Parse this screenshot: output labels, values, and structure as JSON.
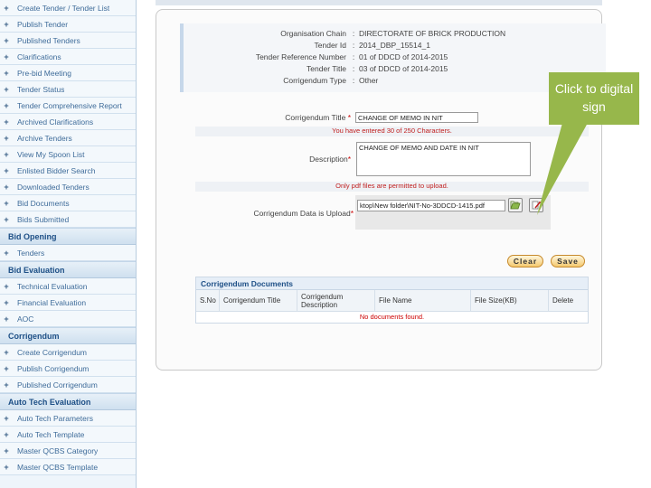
{
  "sidebar": {
    "group1": [
      "Create Tender / Tender List",
      "Publish Tender",
      "Published Tenders",
      "Clarifications",
      "Pre-bid Meeting",
      "Tender Status",
      "Tender Comprehensive Report",
      "Archived Clarifications",
      "Archive Tenders",
      "View My Spoon List",
      "Enlisted Bidder Search",
      "Downloaded Tenders",
      "Bid Documents",
      "Bids Submitted"
    ],
    "bid_opening": {
      "title": "Bid Opening",
      "items": [
        "Tenders"
      ]
    },
    "bid_evaluation": {
      "title": "Bid Evaluation",
      "items": [
        "Technical Evaluation",
        "Financial Evaluation",
        "AOC"
      ]
    },
    "corrigendum": {
      "title": "Corrigendum",
      "items": [
        "Create Corrigendum",
        "Publish Corrigendum",
        "Published Corrigendum"
      ]
    },
    "auto_tech": {
      "title": "Auto Tech Evaluation",
      "items": [
        "Auto Tech Parameters",
        "Auto Tech Template",
        "Master QCBS Category",
        "Master QCBS Template"
      ]
    }
  },
  "info": {
    "org_label": "Organisation Chain",
    "org_value": "DIRECTORATE OF BRICK PRODUCTION",
    "tid_label": "Tender Id",
    "tid_value": "2014_DBP_15514_1",
    "ref_label": "Tender Reference Number",
    "ref_value": "01 of DDCD of 2014-2015",
    "title_label": "Tender Title",
    "title_value": "03 of DDCD of 2014-2015",
    "type_label": "Corrigendum Type",
    "type_value": "Other"
  },
  "form": {
    "ctitle_label": "Corrigendum Title",
    "ctitle_value": "CHANGE OF MEMO IN NIT",
    "char_note": "You have entered 30 of 250 Characters.",
    "desc_label": "Description",
    "desc_value": "CHANGE OF MEMO AND DATE IN NIT",
    "pdf_note": "Only pdf files are permitted to upload.",
    "upload_label": "Corrigendum Data is Upload",
    "upload_value": "ktop\\New folder\\NIT-No-3DDCD-1415.pdf"
  },
  "buttons": {
    "clear": "Clear",
    "save": "Save"
  },
  "docs": {
    "title": "Corrigendum Documents",
    "cols": [
      "S.No",
      "Corrigendum Title",
      "Corrigendum Description",
      "File Name",
      "File Size(KB)",
      "Delete"
    ],
    "empty": "No documents found."
  },
  "callout": {
    "text": "Click to digital sign"
  },
  "colors": {
    "callout": "#97b74b",
    "accent": "#1d4f86"
  }
}
